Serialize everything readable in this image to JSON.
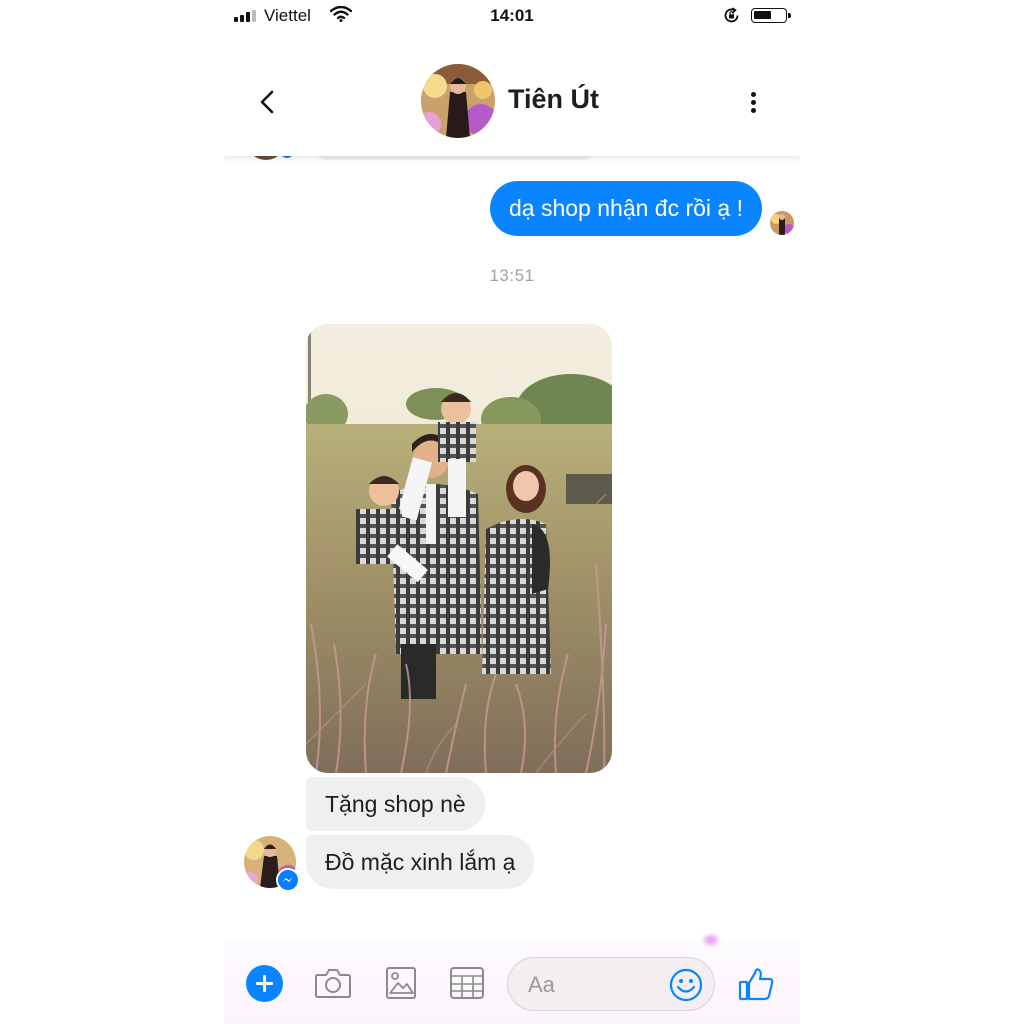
{
  "status_bar": {
    "carrier": "Viettel",
    "time": "14:01",
    "battery_level": 0.5
  },
  "header": {
    "contact_name": "Tiên Út",
    "back_icon": "chevron-left-icon",
    "menu_icon": "vertical-ellipsis-icon"
  },
  "messages": {
    "outgoing_1": "dạ shop nhận đc rồi ạ !",
    "timestamp": "13:51",
    "incoming_1": "Tặng shop nè",
    "incoming_2": "Đồ mặc xinh lắm ạ"
  },
  "composer": {
    "placeholder": "Aa",
    "icons": [
      "plus-icon",
      "camera-icon",
      "image-icon",
      "sticker-icon",
      "emoji-icon",
      "thumbs-up-icon"
    ]
  },
  "colors": {
    "accent": "#0a84ff",
    "incoming_bubble": "#efefef",
    "timestamp": "#9ba1a8"
  }
}
